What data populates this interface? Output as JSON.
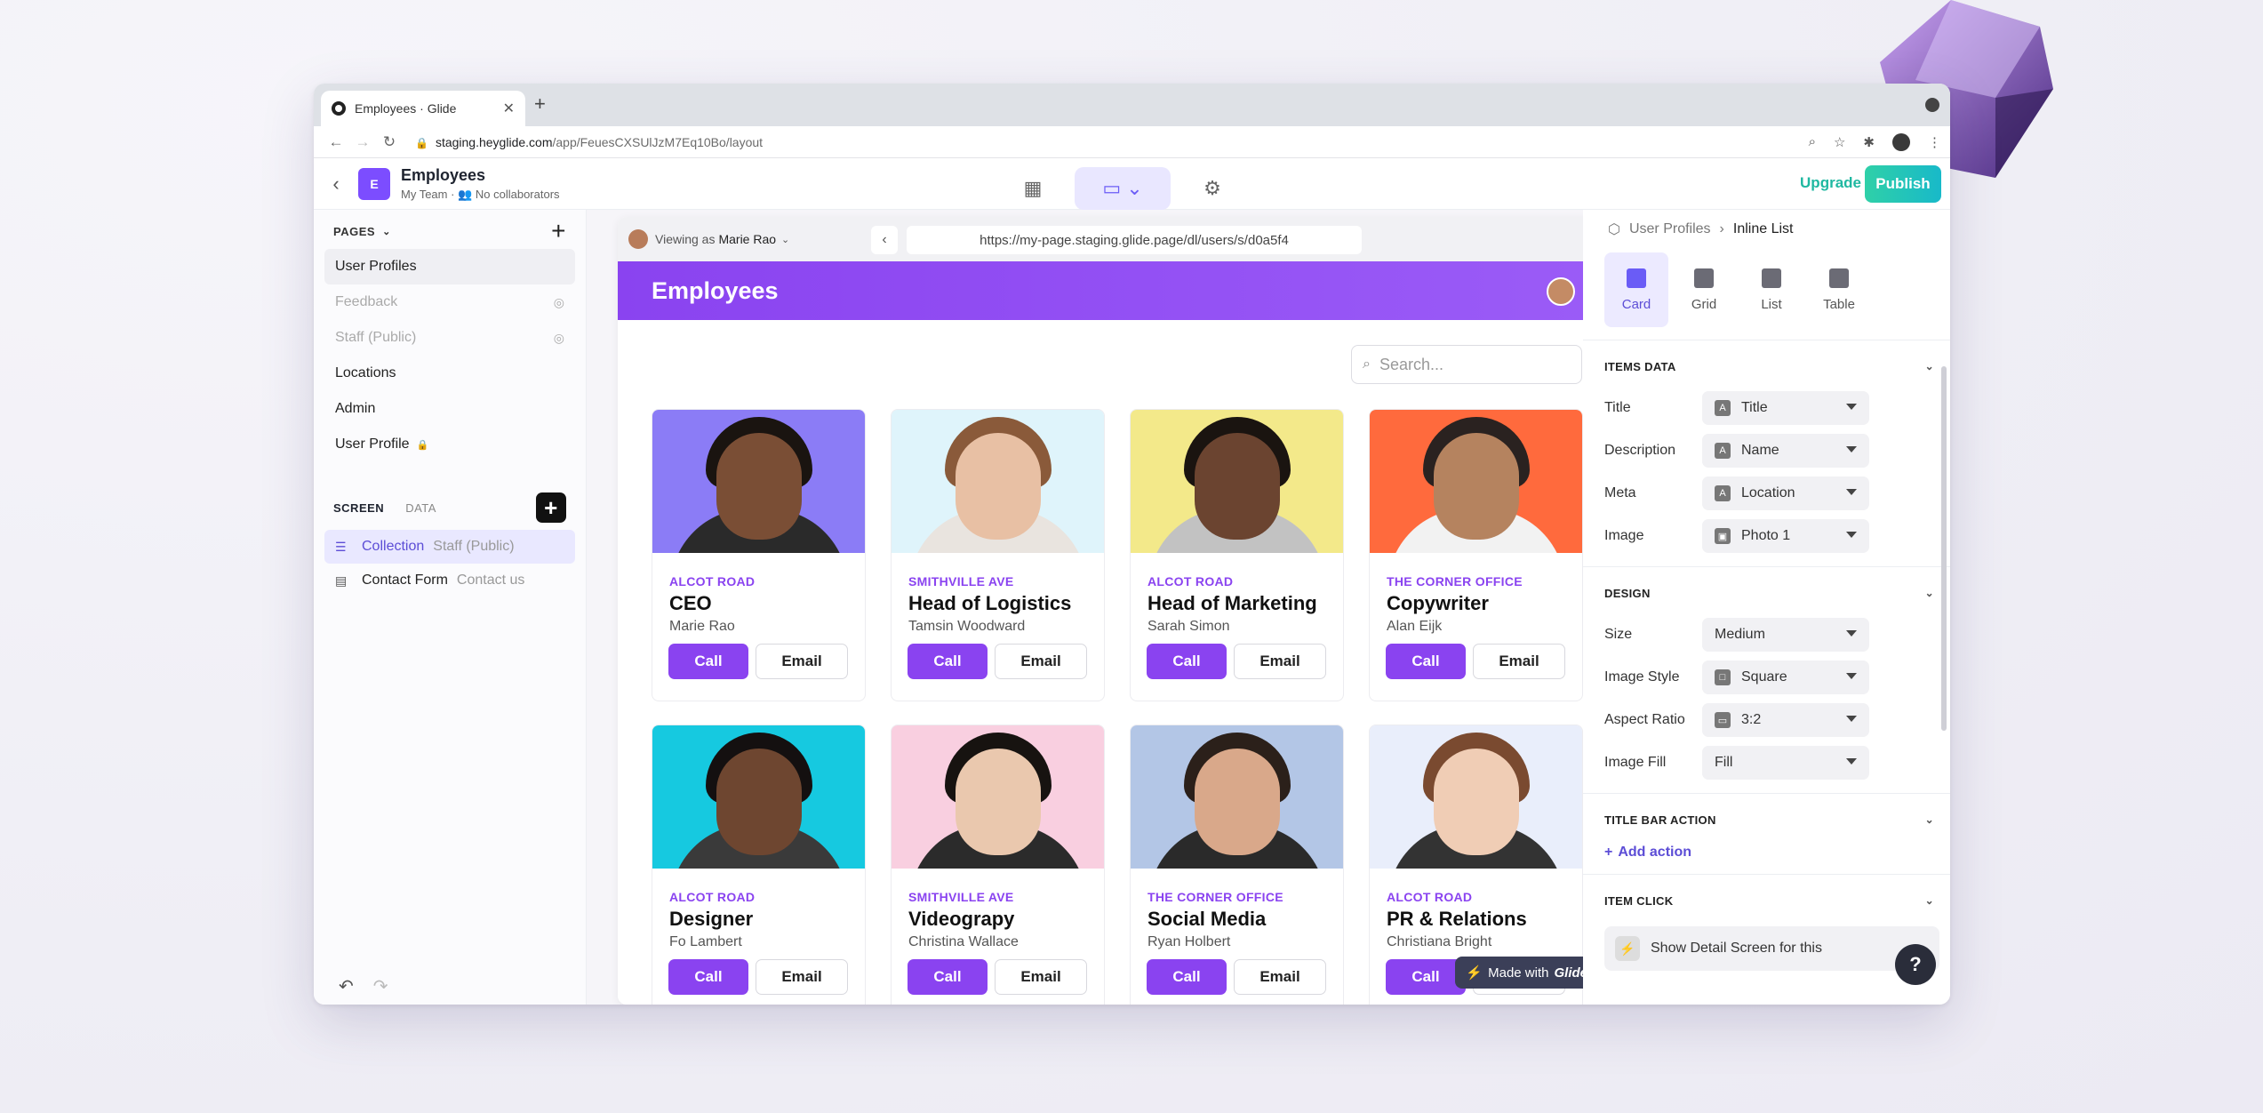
{
  "browser": {
    "tab_title": "Employees · Glide",
    "url_host": "staging.heyglide.com",
    "url_path": "/app/FeuesCXSUlJzM7Eq10Bo/layout"
  },
  "app": {
    "logo_letter": "E",
    "title": "Employees",
    "team": "My Team",
    "collaborators": "No collaborators",
    "upgrade_label": "Upgrade",
    "publish_label": "Publish"
  },
  "pages": {
    "header": "PAGES",
    "items": [
      {
        "label": "User Profiles",
        "state": "active"
      },
      {
        "label": "Feedback",
        "state": "hidden"
      },
      {
        "label": "Staff (Public)",
        "state": "hidden"
      },
      {
        "label": "Locations",
        "state": "normal"
      },
      {
        "label": "Admin",
        "state": "normal"
      },
      {
        "label": "User Profile",
        "state": "locked"
      }
    ]
  },
  "screen": {
    "tab_screen": "SCREEN",
    "tab_data": "DATA",
    "components": [
      {
        "label": "Collection",
        "sub": "Staff (Public)"
      },
      {
        "label": "Contact Form",
        "sub": "Contact us"
      }
    ]
  },
  "preview": {
    "viewing_prefix": "Viewing as",
    "viewing_user": "Marie Rao",
    "url": "https://my-page.staging.glide.page/dl/users/s/d0a5f4",
    "app_title": "Employees",
    "search_placeholder": "Search...",
    "made_with_prefix": "Made with",
    "made_with_brand": "Glide",
    "call_label": "Call",
    "email_label": "Email",
    "cards": [
      {
        "loc": "ALCOT ROAD",
        "role": "CEO",
        "name": "Marie Rao",
        "bg": "#8b7cf6",
        "skin": "#7a4e35",
        "hair": "#1a1410",
        "shirt": "#2a2a2a"
      },
      {
        "loc": "SMITHVILLE AVE",
        "role": "Head of Logistics",
        "name": "Tamsin Woodward",
        "bg": "#dff4fb",
        "skin": "#e8c0a4",
        "hair": "#8a5a3a",
        "shirt": "#e9e4df"
      },
      {
        "loc": "ALCOT ROAD",
        "role": "Head of Marketing",
        "name": "Sarah Simon",
        "bg": "#f3e98a",
        "skin": "#6b4430",
        "hair": "#1a1410",
        "shirt": "#c2c2c2"
      },
      {
        "loc": "THE CORNER OFFICE",
        "role": "Copywriter",
        "name": "Alan Eijk",
        "bg": "#ff6a3d",
        "skin": "#b5835f",
        "hair": "#2a2220",
        "shirt": "#f2f2f2"
      },
      {
        "loc": "ALCOT ROAD",
        "role": "Designer",
        "name": "Fo Lambert",
        "bg": "#16c9e0",
        "skin": "#6e4630",
        "hair": "#141010",
        "shirt": "#3a3a3a"
      },
      {
        "loc": "SMITHVILLE AVE",
        "role": "Videograpy",
        "name": "Christina Wallace",
        "bg": "#f9cfe0",
        "skin": "#eac8ae",
        "hair": "#171310",
        "shirt": "#2b2b2b"
      },
      {
        "loc": "THE CORNER OFFICE",
        "role": "Social Media",
        "name": "Ryan Holbert",
        "bg": "#b3c6e6",
        "skin": "#d9a88a",
        "hair": "#2b201a",
        "shirt": "#2a2a2a"
      },
      {
        "loc": "ALCOT ROAD",
        "role": "PR & Relations",
        "name": "Christiana Bright",
        "bg": "#e9eefb",
        "skin": "#f0cdb5",
        "hair": "#7a4a30",
        "shirt": "#333333"
      }
    ]
  },
  "inspector": {
    "crumb_parent": "User Profiles",
    "crumb_current": "Inline List",
    "layouts": [
      {
        "label": "Card",
        "active": true
      },
      {
        "label": "Grid",
        "active": false
      },
      {
        "label": "List",
        "active": false
      },
      {
        "label": "Table",
        "active": false
      }
    ],
    "items_data_header": "ITEMS DATA",
    "items_data": [
      {
        "label": "Title",
        "value": "Title",
        "icon": "A"
      },
      {
        "label": "Description",
        "value": "Name",
        "icon": "A"
      },
      {
        "label": "Meta",
        "value": "Location",
        "icon": "A"
      },
      {
        "label": "Image",
        "value": "Photo 1",
        "icon": "▣"
      }
    ],
    "design_header": "DESIGN",
    "design": [
      {
        "label": "Size",
        "value": "Medium",
        "icon": ""
      },
      {
        "label": "Image Style",
        "value": "Square",
        "icon": "□"
      },
      {
        "label": "Aspect Ratio",
        "value": "3:2",
        "icon": "▭"
      },
      {
        "label": "Image Fill",
        "value": "Fill",
        "icon": ""
      }
    ],
    "title_bar_header": "TITLE BAR ACTION",
    "add_action_label": "Add action",
    "item_click_header": "ITEM CLICK",
    "item_click_value": "Show Detail Screen for this",
    "help_label": "?"
  }
}
